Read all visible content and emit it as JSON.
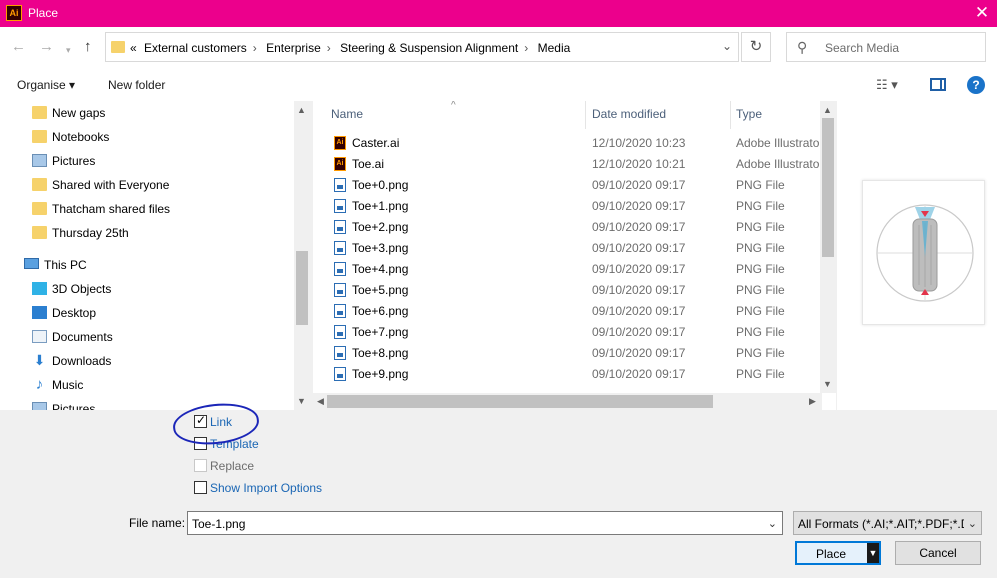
{
  "window": {
    "title": "Place",
    "app_icon_text": "Ai"
  },
  "address": {
    "overflow": "«",
    "crumbs": [
      "External customers",
      "Enterprise",
      "Steering & Suspension Alignment",
      "Media"
    ],
    "separator": "›"
  },
  "search": {
    "placeholder": "Search Media"
  },
  "toolbar": {
    "organise": "Organise ▾",
    "new_folder": "New folder",
    "help": "?"
  },
  "nav_pane": {
    "items": [
      {
        "label": "New gaps",
        "icon": "folder-icon"
      },
      {
        "label": "Notebooks",
        "icon": "folder-icon"
      },
      {
        "label": "Pictures",
        "icon": "pictures-icon"
      },
      {
        "label": "Shared with Everyone",
        "icon": "folder-icon"
      },
      {
        "label": "Thatcham shared files",
        "icon": "folder-icon"
      },
      {
        "label": "Thursday 25th",
        "icon": "folder-icon"
      },
      {
        "label": "This PC",
        "icon": "computer-icon"
      },
      {
        "label": "3D Objects",
        "icon": "3d-objects-icon"
      },
      {
        "label": "Desktop",
        "icon": "desktop-icon"
      },
      {
        "label": "Documents",
        "icon": "documents-icon"
      },
      {
        "label": "Downloads",
        "icon": "downloads-icon"
      },
      {
        "label": "Music",
        "icon": "music-icon"
      },
      {
        "label": "Pictures",
        "icon": "pictures-icon"
      }
    ]
  },
  "file_list": {
    "columns": {
      "name": "Name",
      "date": "Date modified",
      "type": "Type"
    },
    "rows": [
      {
        "name": "Caster.ai",
        "date": "12/10/2020 10:23",
        "type": "Adobe Illustrator",
        "kind": "ai"
      },
      {
        "name": "Toe.ai",
        "date": "12/10/2020 10:21",
        "type": "Adobe Illustrator",
        "kind": "ai"
      },
      {
        "name": "Toe+0.png",
        "date": "09/10/2020 09:17",
        "type": "PNG File",
        "kind": "png"
      },
      {
        "name": "Toe+1.png",
        "date": "09/10/2020 09:17",
        "type": "PNG File",
        "kind": "png"
      },
      {
        "name": "Toe+2.png",
        "date": "09/10/2020 09:17",
        "type": "PNG File",
        "kind": "png"
      },
      {
        "name": "Toe+3.png",
        "date": "09/10/2020 09:17",
        "type": "PNG File",
        "kind": "png"
      },
      {
        "name": "Toe+4.png",
        "date": "09/10/2020 09:17",
        "type": "PNG File",
        "kind": "png"
      },
      {
        "name": "Toe+5.png",
        "date": "09/10/2020 09:17",
        "type": "PNG File",
        "kind": "png"
      },
      {
        "name": "Toe+6.png",
        "date": "09/10/2020 09:17",
        "type": "PNG File",
        "kind": "png"
      },
      {
        "name": "Toe+7.png",
        "date": "09/10/2020 09:17",
        "type": "PNG File",
        "kind": "png"
      },
      {
        "name": "Toe+8.png",
        "date": "09/10/2020 09:17",
        "type": "PNG File",
        "kind": "png"
      },
      {
        "name": "Toe+9.png",
        "date": "09/10/2020 09:17",
        "type": "PNG File",
        "kind": "png"
      }
    ]
  },
  "options": {
    "link": {
      "label": "Link",
      "checked": true
    },
    "template": {
      "label": "Template",
      "checked": false
    },
    "replace": {
      "label": "Replace",
      "checked": false,
      "disabled": true
    },
    "show_import": {
      "label": "Show Import Options",
      "checked": false
    }
  },
  "file_name": {
    "label": "File name:",
    "value": "Toe-1.png"
  },
  "filter": {
    "value": "All Formats (*.AI;*.AIT;*.PDF;*.D"
  },
  "buttons": {
    "place": "Place",
    "cancel": "Cancel"
  },
  "colors": {
    "titlebar": "#ec008c",
    "annotation": "#1b26b8",
    "accent": "#0078d7"
  }
}
